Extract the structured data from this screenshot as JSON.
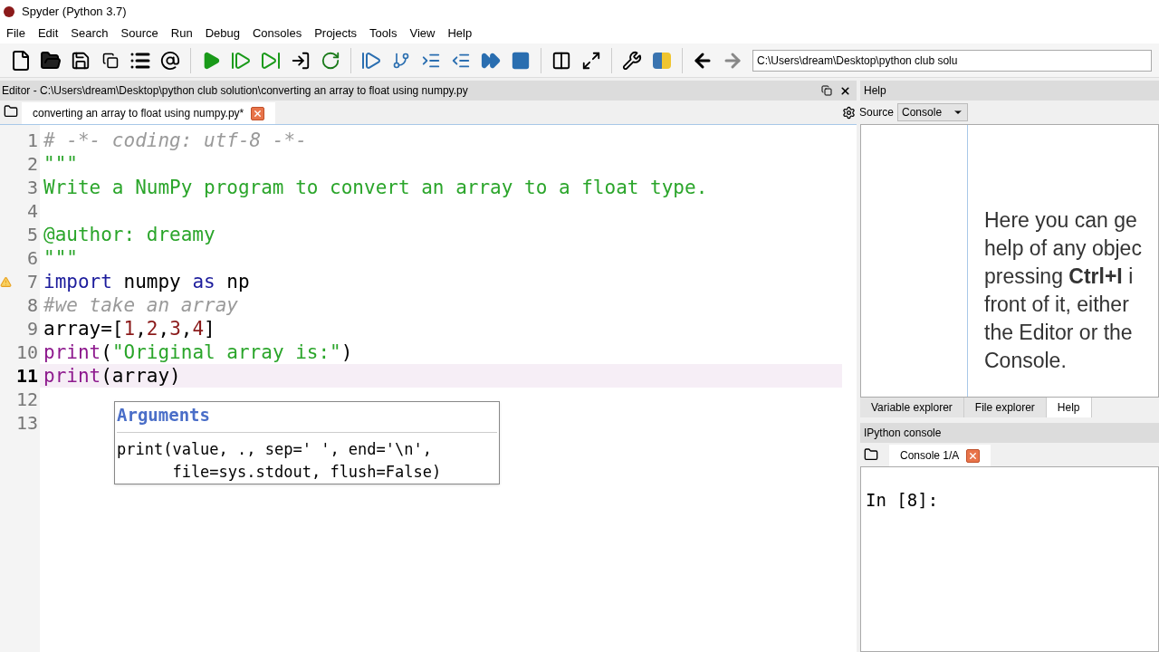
{
  "window": {
    "title": "Spyder (Python 3.7)"
  },
  "menu": [
    "File",
    "Edit",
    "Search",
    "Source",
    "Run",
    "Debug",
    "Consoles",
    "Projects",
    "Tools",
    "View",
    "Help"
  ],
  "toolbar": {
    "path": "C:\\Users\\dream\\Desktop\\python club solu"
  },
  "editor": {
    "header": "Editor - C:\\Users\\dream\\Desktop\\python club solution\\converting an array to float using numpy.py",
    "tabs": [
      {
        "label": "converting an array to float using numpy.py*",
        "selected": true
      }
    ],
    "lines": [
      {
        "number": "1",
        "current": false,
        "warning": false,
        "tokens": [
          {
            "kind": "comment",
            "text": "# -*- coding: utf-8 -*-"
          }
        ]
      },
      {
        "number": "2",
        "current": false,
        "warning": false,
        "tokens": [
          {
            "kind": "docstring",
            "text": "\"\"\""
          }
        ]
      },
      {
        "number": "3",
        "current": false,
        "warning": false,
        "tokens": [
          {
            "kind": "docstring",
            "text": "Write a NumPy program to convert an array to a float type."
          }
        ]
      },
      {
        "number": "4",
        "current": false,
        "warning": false
      },
      {
        "number": "5",
        "current": false,
        "warning": false,
        "tokens": [
          {
            "kind": "docstring",
            "text": "@author: dreamy"
          }
        ]
      },
      {
        "number": "6",
        "current": false,
        "warning": false,
        "tokens": [
          {
            "kind": "docstring",
            "text": "\"\"\""
          }
        ]
      },
      {
        "number": "7",
        "current": false,
        "warning": true,
        "tokens": [
          {
            "kind": "keyword",
            "text": "import"
          },
          {
            "kind": "plain",
            "text": " numpy "
          },
          {
            "kind": "keyword",
            "text": "as"
          },
          {
            "kind": "plain",
            "text": " np"
          }
        ]
      },
      {
        "number": "8",
        "current": false,
        "warning": false,
        "tokens": [
          {
            "kind": "comment",
            "text": "#we take an array"
          }
        ]
      },
      {
        "number": "9",
        "current": false,
        "warning": false,
        "tokens": [
          {
            "kind": "plain",
            "text": "array=["
          },
          {
            "kind": "number",
            "text": "1"
          },
          {
            "kind": "plain",
            "text": ","
          },
          {
            "kind": "number",
            "text": "2"
          },
          {
            "kind": "plain",
            "text": ","
          },
          {
            "kind": "number",
            "text": "3"
          },
          {
            "kind": "plain",
            "text": ","
          },
          {
            "kind": "number",
            "text": "4"
          },
          {
            "kind": "plain",
            "text": "]"
          }
        ]
      },
      {
        "number": "10",
        "current": false,
        "warning": false,
        "tokens": [
          {
            "kind": "builtin",
            "text": "print"
          },
          {
            "kind": "plain",
            "text": "("
          },
          {
            "kind": "docstring",
            "text": "\"Original array is:\""
          },
          {
            "kind": "plain",
            "text": ")"
          }
        ]
      },
      {
        "number": "11",
        "current": true,
        "warning": false,
        "tokens": [
          {
            "kind": "builtin",
            "text": "print"
          },
          {
            "kind": "plain",
            "text": "(array)"
          }
        ]
      },
      {
        "number": "12",
        "current": false,
        "warning": false
      },
      {
        "number": "13",
        "current": false,
        "warning": false
      }
    ],
    "calltip": {
      "title": "Arguments",
      "lines": [
        "print(value, ., sep=' ', end='\\n',",
        "      file=sys.stdout, flush=False)"
      ]
    }
  },
  "help": {
    "title": "Help",
    "source_label": "Source",
    "source_value": "Console",
    "text_lines": [
      "Here you can ge",
      "help of any objec",
      "pressing **Ctrl+I** i",
      "front of it, either",
      "the Editor or the",
      "Console."
    ],
    "tabs": [
      {
        "label": "Variable explorer",
        "selected": false
      },
      {
        "label": "File explorer",
        "selected": false
      },
      {
        "label": "Help",
        "selected": true
      }
    ]
  },
  "console": {
    "title": "IPython console",
    "tabs": [
      {
        "label": "Console 1/A",
        "selected": true
      }
    ],
    "prompt": "In [8]:"
  }
}
